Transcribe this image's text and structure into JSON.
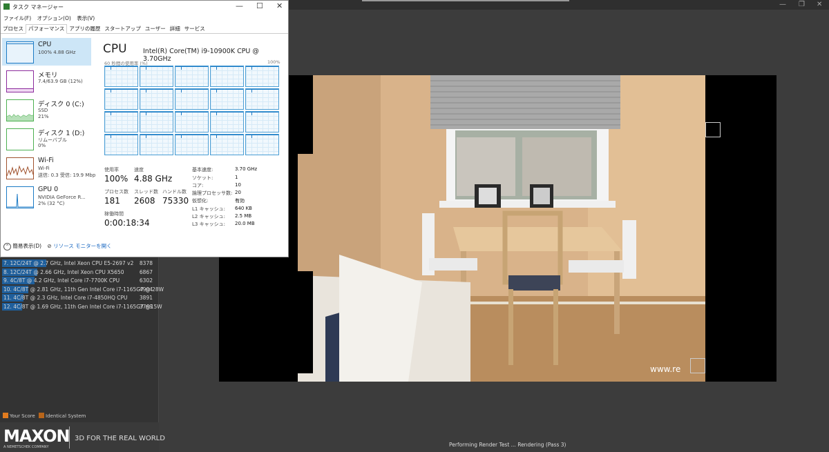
{
  "task_manager": {
    "title": "タスク マネージャー",
    "menu": [
      "ファイル(F)",
      "オプション(O)",
      "表示(V)"
    ],
    "tabs": [
      "プロセス",
      "パフォーマンス",
      "アプリの履歴",
      "スタートアップ",
      "ユーザー",
      "詳細",
      "サービス"
    ],
    "active_tab": "パフォーマンス",
    "resources": [
      {
        "name": "CPU",
        "line1": "100% 4.88 GHz",
        "line2": "",
        "color": "#1b7ac5"
      },
      {
        "name": "メモリ",
        "line1": "7.4/63.9 GB (12%)",
        "line2": "",
        "color": "#8b2a9c"
      },
      {
        "name": "ディスク 0 (C:)",
        "line1": "SSD",
        "line2": "21%",
        "color": "#4caf50"
      },
      {
        "name": "ディスク 1 (D:)",
        "line1": "リムーバブル",
        "line2": "0%",
        "color": "#4caf50"
      },
      {
        "name": "Wi-Fi",
        "line1": "Wi-Fi",
        "line2": "送信: 0.3 受信: 19.9 Mbp",
        "color": "#a0522d"
      },
      {
        "name": "GPU 0",
        "line1": "NVIDIA GeForce R...",
        "line2": "2% (32 °C)",
        "color": "#1b7ac5"
      }
    ],
    "cpu": {
      "heading": "CPU",
      "model": "Intel(R) Core(TM) i9-10900K CPU @ 3.70GHz",
      "graph_label": "60 秒間の使用率 (%)",
      "graph_max": "100%",
      "utilization_label": "使用率",
      "utilization": "100%",
      "speed_label": "速度",
      "speed": "4.88 GHz",
      "processes_label": "プロセス数",
      "processes": "181",
      "threads_label": "スレッド数",
      "threads": "2608",
      "handles_label": "ハンドル数",
      "handles": "75330",
      "uptime_label": "稼働時間",
      "uptime": "0:00:18:34",
      "specs": [
        {
          "k": "基本速度:",
          "v": "3.70 GHz"
        },
        {
          "k": "ソケット:",
          "v": "1"
        },
        {
          "k": "コア:",
          "v": "10"
        },
        {
          "k": "論理プロセッサ数:",
          "v": "20"
        },
        {
          "k": "仮想化:",
          "v": "有効"
        },
        {
          "k": "L1 キャッシュ:",
          "v": "640 KB"
        },
        {
          "k": "L2 キャッシュ:",
          "v": "2.5 MB"
        },
        {
          "k": "L3 キャッシュ:",
          "v": "20.0 MB"
        }
      ]
    },
    "bottom": {
      "simple": "簡易表示(D)",
      "monitor": "リソース モニターを開く"
    }
  },
  "cinebench": {
    "ranking": [
      {
        "label": "7. 12C/24T @ 2.7 GHz, Intel Xeon CPU E5-2697 v2",
        "score": "8378",
        "fraction": 0.29
      },
      {
        "label": "8. 12C/24T @ 2.66 GHz, Intel Xeon CPU X5650",
        "score": "6867",
        "fraction": 0.23
      },
      {
        "label": "9. 4C/8T @ 4.2 GHz, Intel Core i7-7700K CPU",
        "score": "6302",
        "fraction": 0.21
      },
      {
        "label": "10. 4C/8T @ 2.81 GHz, 11th Gen Intel Core i7-1165G7 @ 28W",
        "score": "4904",
        "fraction": 0.17
      },
      {
        "label": "11. 4C/8T @ 2.3 GHz, Intel Core i7-4850HQ CPU",
        "score": "3891",
        "fraction": 0.14
      },
      {
        "label": "12. 4C/8T @ 1.69 GHz, 11th Gen Intel Core i7-1165G7 @15W",
        "score": "3769",
        "fraction": 0.13
      }
    ],
    "legend": {
      "your_score": "Your Score",
      "identical": "Identical System",
      "your_color": "#e07b1f",
      "identical_color": "#b8651a"
    },
    "brand": "MAXON",
    "brand_sub": "A NEMETSCHEK COMPANY",
    "tagline": "3D FOR THE REAL WORLD",
    "status": "Performing Render Test ... Rendering (Pass 3)",
    "watermark": "www.re"
  }
}
